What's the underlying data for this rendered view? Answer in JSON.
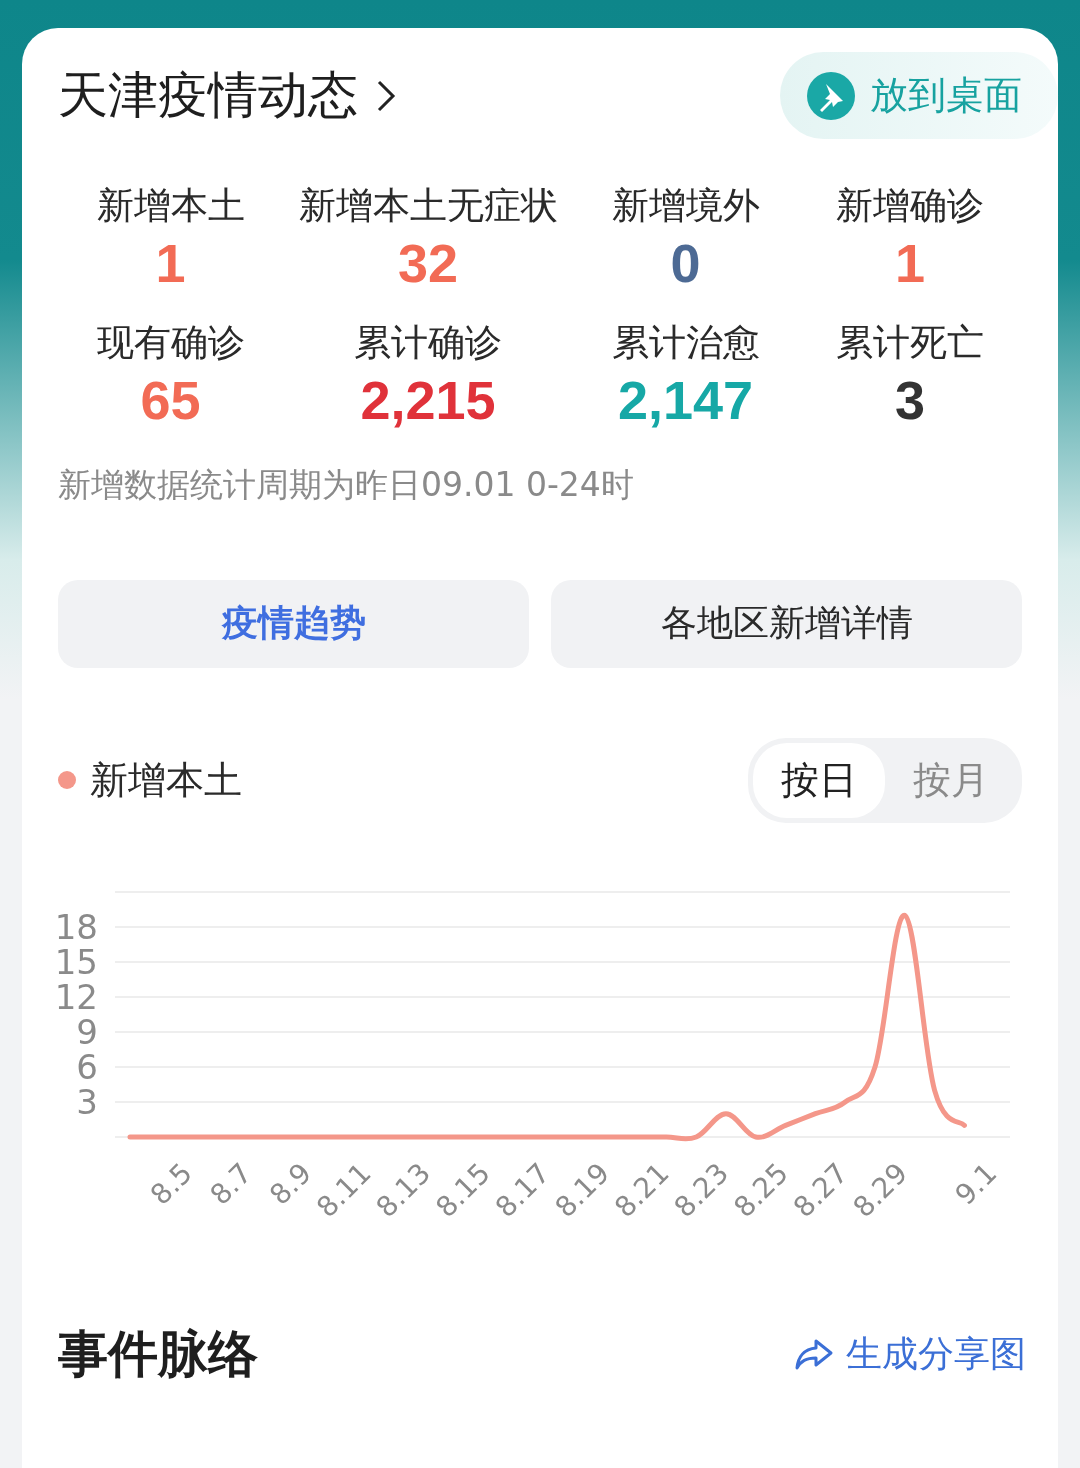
{
  "header": {
    "title": "天津疫情动态",
    "action": "放到桌面"
  },
  "stats": [
    {
      "label": "新增本土",
      "value": "1",
      "color": "#f26b55"
    },
    {
      "label": "新增本土无症状",
      "value": "32",
      "color": "#f26b55"
    },
    {
      "label": "新增境外",
      "value": "0",
      "color": "#4d6a94"
    },
    {
      "label": "新增确诊",
      "value": "1",
      "color": "#f26b55"
    },
    {
      "label": "现有确诊",
      "value": "65",
      "color": "#f26b55"
    },
    {
      "label": "累计确诊",
      "value": "2,215",
      "color": "#e0323a"
    },
    {
      "label": "累计治愈",
      "value": "2,147",
      "color": "#16a8a6"
    },
    {
      "label": "累计死亡",
      "value": "3",
      "color": "#333333"
    }
  ],
  "note": "新增数据统计周期为昨日09.01 0-24时",
  "tabs": [
    {
      "label": "疫情趋势",
      "selected": true
    },
    {
      "label": "各地区新增详情",
      "selected": false
    }
  ],
  "trend": {
    "period_toggle": [
      {
        "label": "按日",
        "selected": true
      },
      {
        "label": "按月",
        "selected": false
      }
    ],
    "chart_data": {
      "type": "line",
      "grid": true,
      "x": [
        null,
        "8.5",
        null,
        "8.7",
        null,
        "8.9",
        null,
        "8.11",
        null,
        "8.13",
        null,
        "8.15",
        null,
        "8.17",
        null,
        "8.19",
        null,
        "8.21",
        null,
        "8.23",
        null,
        "8.25",
        null,
        "8.27",
        null,
        "8.29",
        null,
        null,
        "9.1"
      ],
      "series": [
        {
          "name": "新增本土",
          "color": "#f4978a",
          "values": [
            0,
            0,
            0,
            0,
            0,
            0,
            0,
            0,
            0,
            0,
            0,
            0,
            0,
            0,
            0,
            0,
            0,
            0,
            0,
            0,
            2,
            0,
            1,
            2,
            3,
            6,
            19,
            4,
            1
          ]
        }
      ],
      "ylim": [
        0,
        21
      ],
      "yticks": [
        3,
        6,
        9,
        12,
        15,
        18
      ]
    }
  },
  "footer": {
    "title": "事件脉络",
    "action": "生成分享图"
  }
}
